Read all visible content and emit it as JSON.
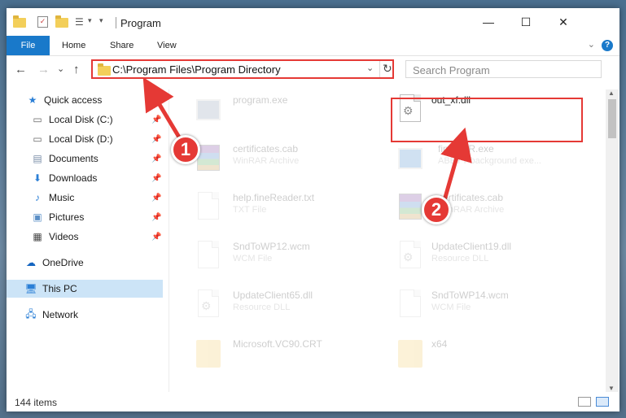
{
  "window": {
    "title": "Program",
    "controls": {
      "minimize": "—",
      "maximize": "☐",
      "close": "✕"
    }
  },
  "ribbon": {
    "tabs": [
      "File",
      "Home",
      "Share",
      "View"
    ],
    "help": "?"
  },
  "nav": {
    "back": "←",
    "forward": "→",
    "recent": "⌄",
    "up": "↑",
    "address": "C:\\Program Files\\Program Directory",
    "refresh": "↻",
    "search_placeholder": "Search Program"
  },
  "sidebar": {
    "items": [
      {
        "label": "Quick access",
        "icon": "star-icon",
        "pinned": false
      },
      {
        "label": "Local Disk (C:)",
        "icon": "drive-icon",
        "pinned": true
      },
      {
        "label": "Local Disk (D:)",
        "icon": "drive-icon",
        "pinned": true
      },
      {
        "label": "Documents",
        "icon": "documents-icon",
        "pinned": true
      },
      {
        "label": "Downloads",
        "icon": "download-icon",
        "pinned": true
      },
      {
        "label": "Music",
        "icon": "music-icon",
        "pinned": true
      },
      {
        "label": "Pictures",
        "icon": "pictures-icon",
        "pinned": true
      },
      {
        "label": "Videos",
        "icon": "videos-icon",
        "pinned": true
      },
      {
        "label": "OneDrive",
        "icon": "cloud-icon",
        "pinned": false
      },
      {
        "label": "This PC",
        "icon": "computer-icon",
        "pinned": false,
        "selected": true
      },
      {
        "label": "Network",
        "icon": "network-icon",
        "pinned": false
      }
    ]
  },
  "files": [
    {
      "name": "program.exe",
      "type": "",
      "icon": "program-icon"
    },
    {
      "name": "out_xf.dll",
      "type": "",
      "icon": "dll-icon"
    },
    {
      "name": "certificates.cab",
      "type": "WinRAR Archive",
      "icon": "archive-icon"
    },
    {
      "name": "fineOCR.exe",
      "type": "ABBYY background exe...",
      "icon": "exe-icon"
    },
    {
      "name": "help.fineReader.txt",
      "type": "TXT File",
      "icon": "text-file-icon"
    },
    {
      "name": "certificates.cab",
      "type": "WinRAR Archive",
      "icon": "archive-icon"
    },
    {
      "name": "SndToWP12.wcm",
      "type": "WCM File",
      "icon": "file-icon"
    },
    {
      "name": "UpdateClient19.dll",
      "type": "Resource DLL",
      "icon": "dll-icon"
    },
    {
      "name": "UpdateClient65.dll",
      "type": "Resource DLL",
      "icon": "dll-icon"
    },
    {
      "name": "SndToWP14.wcm",
      "type": "WCM File",
      "icon": "file-icon"
    },
    {
      "name": "Microsoft.VC90.CRT",
      "type": "",
      "icon": "folder-icon"
    },
    {
      "name": "x64",
      "type": "",
      "icon": "folder-icon"
    }
  ],
  "status": {
    "count": "144 items"
  },
  "annotations": {
    "step1": "1",
    "step2": "2",
    "color": "#e53935"
  }
}
